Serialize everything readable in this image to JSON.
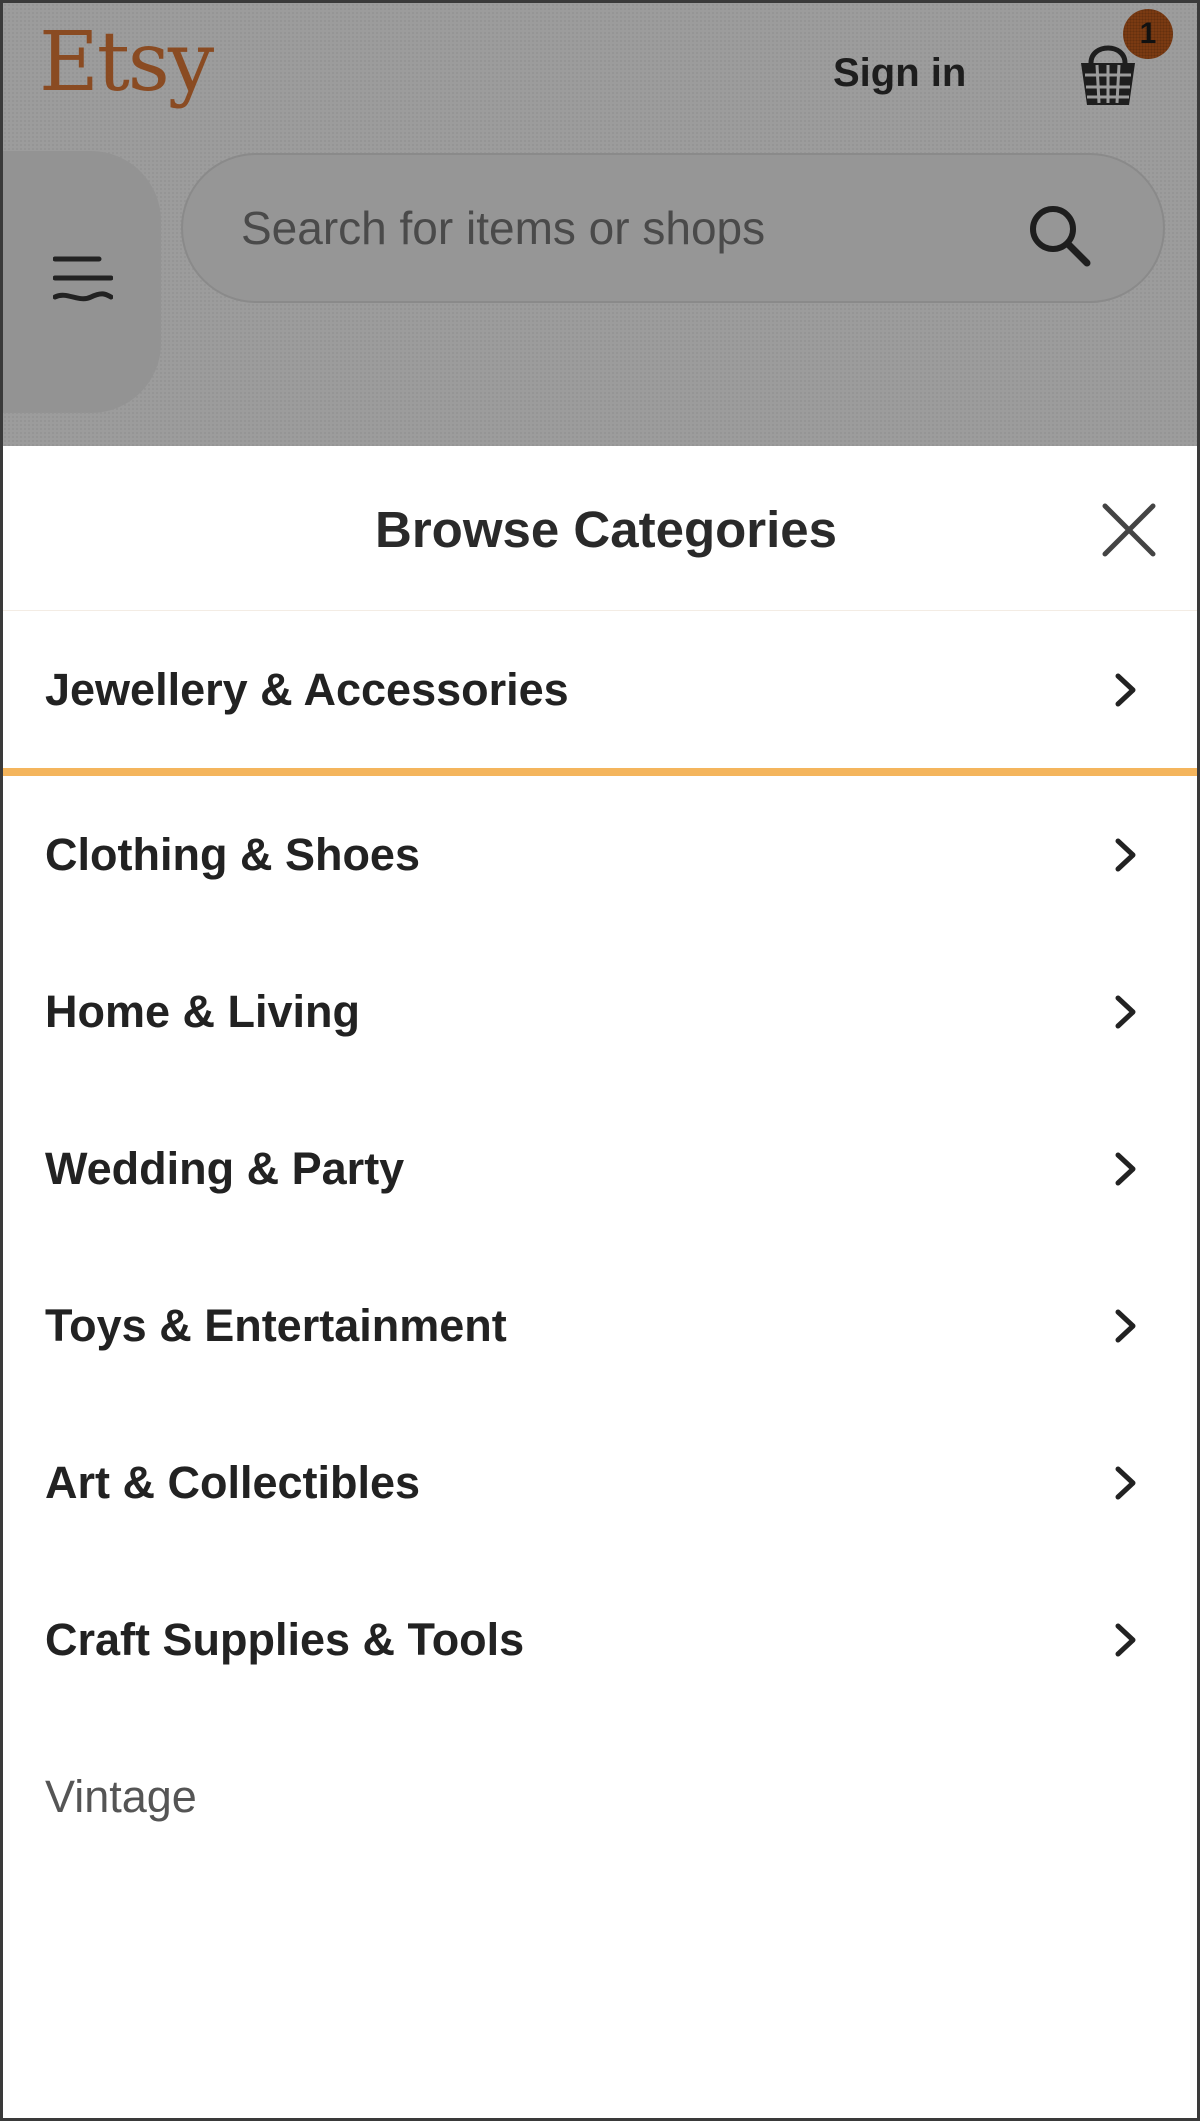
{
  "header": {
    "logo": "Etsy",
    "sign_in": "Sign in",
    "cart_count": "1",
    "cart_icon": "basket-icon",
    "menu_icon": "hamburger-menu-icon",
    "search": {
      "placeholder": "Search for items or shops",
      "icon": "search-icon"
    },
    "overlay_color": "#9c9c9c",
    "logo_color": "#8a4b22"
  },
  "panel": {
    "title": "Browse Categories",
    "close_icon": "close-icon",
    "active_underline_color": "#f4b55d",
    "categories": [
      {
        "label": "Jewellery & Accessories"
      },
      {
        "label": "Clothing & Shoes"
      },
      {
        "label": "Home & Living"
      },
      {
        "label": "Wedding & Party"
      },
      {
        "label": "Toys & Entertainment"
      },
      {
        "label": "Art & Collectibles"
      },
      {
        "label": "Craft Supplies & Tools"
      },
      {
        "label": "Vintage"
      }
    ]
  }
}
